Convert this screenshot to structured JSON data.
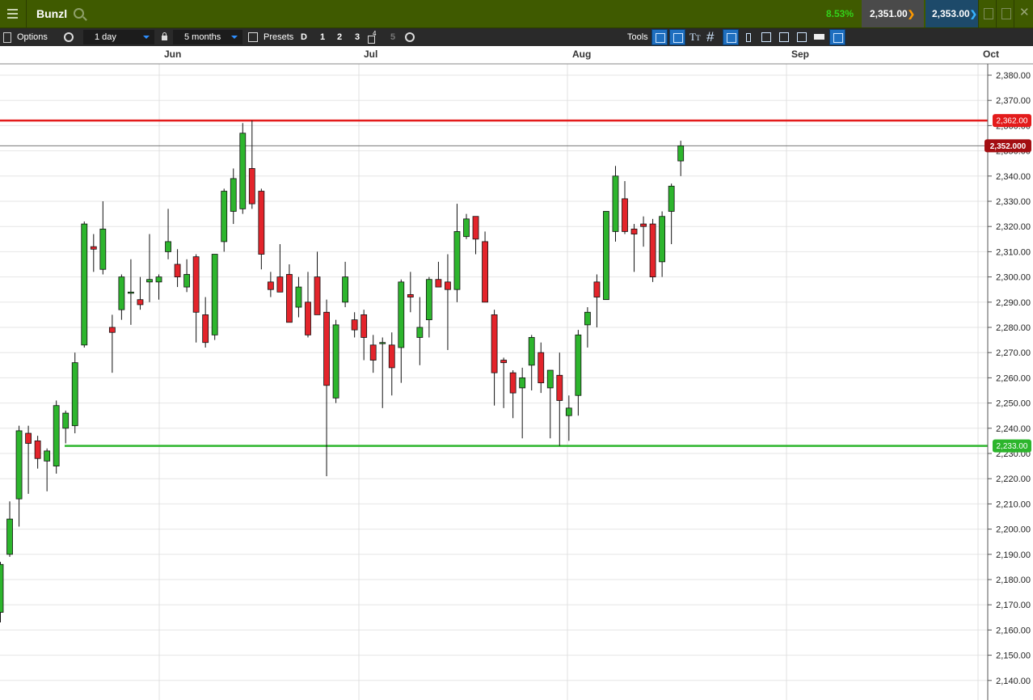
{
  "header": {
    "title": "Bunzl",
    "change": "8.53%",
    "sell": "2,351.00",
    "buy": "2,353.00"
  },
  "toolbar": {
    "options_label": "Options",
    "interval_value": "1 day",
    "range_value": "5 months",
    "presets_label": "Presets",
    "preset_buttons": [
      "D",
      "1",
      "2",
      "3",
      "4",
      "5"
    ],
    "tools_label": "Tools"
  },
  "colors": {
    "up": "#2db52d",
    "down": "#e3242b",
    "resistance": "#e31b1b",
    "support": "#2cb52c",
    "current": "#a30e12"
  },
  "chart_data": {
    "type": "candlestick",
    "title": "",
    "xlabel": "",
    "ylabel": "",
    "x_ticks": [
      "Jun",
      "Jul",
      "Aug",
      "Sep",
      "Oct"
    ],
    "ylim": [
      2135,
      2392
    ],
    "y_ticks": [
      2140,
      2150,
      2160,
      2170,
      2180,
      2190,
      2200,
      2210,
      2220,
      2230,
      2240,
      2250,
      2260,
      2270,
      2280,
      2290,
      2300,
      2310,
      2320,
      2330,
      2340,
      2350,
      2360,
      2370,
      2380
    ],
    "y_tick_labels": [
      "2,140.00",
      "2,150.00",
      "2,160.00",
      "2,170.00",
      "2,180.00",
      "2,190.00",
      "2,200.00",
      "2,210.00",
      "2,220.00",
      "2,230.00",
      "2,240.00",
      "2,250.00",
      "2,260.00",
      "2,270.00",
      "2,280.00",
      "2,290.00",
      "2,300.00",
      "2,310.00",
      "2,320.00",
      "2,330.00",
      "2,340.00",
      "2,350.00",
      "2,360.00",
      "2,370.00",
      "2,380.00"
    ],
    "grid": true,
    "candles": [
      {
        "date": "05-24",
        "o": 2167,
        "h": 2187,
        "l": 2163,
        "c": 2186
      },
      {
        "date": "05-25",
        "o": 2190,
        "h": 2211,
        "l": 2189,
        "c": 2204
      },
      {
        "date": "05-26",
        "o": 2212,
        "h": 2241,
        "l": 2201,
        "c": 2239
      },
      {
        "date": "05-29",
        "o": 2238,
        "h": 2241,
        "l": 2214,
        "c": 2234
      },
      {
        "date": "05-30",
        "o": 2235,
        "h": 2237,
        "l": 2224,
        "c": 2228
      },
      {
        "date": "05-31",
        "o": 2227,
        "h": 2232,
        "l": 2215,
        "c": 2231
      },
      {
        "date": "06-01",
        "o": 2225,
        "h": 2251,
        "l": 2222,
        "c": 2249
      },
      {
        "date": "06-02",
        "o": 2240,
        "h": 2247,
        "l": 2234,
        "c": 2246
      },
      {
        "date": "06-05",
        "o": 2241,
        "h": 2270,
        "l": 2238,
        "c": 2266
      },
      {
        "date": "06-06",
        "o": 2273,
        "h": 2322,
        "l": 2272,
        "c": 2321
      },
      {
        "date": "06-07",
        "o": 2312,
        "h": 2317,
        "l": 2302,
        "c": 2311
      },
      {
        "date": "06-08",
        "o": 2303,
        "h": 2330,
        "l": 2301,
        "c": 2319
      },
      {
        "date": "06-09",
        "o": 2280,
        "h": 2285,
        "l": 2262,
        "c": 2278
      },
      {
        "date": "06-12",
        "o": 2287,
        "h": 2301,
        "l": 2283,
        "c": 2300
      },
      {
        "date": "06-13",
        "o": 2294,
        "h": 2307,
        "l": 2281,
        "c": 2294
      },
      {
        "date": "06-14",
        "o": 2291,
        "h": 2300,
        "l": 2287,
        "c": 2289
      },
      {
        "date": "06-15",
        "o": 2298,
        "h": 2317,
        "l": 2290,
        "c": 2299
      },
      {
        "date": "06-16",
        "o": 2298,
        "h": 2301,
        "l": 2291,
        "c": 2300
      },
      {
        "date": "06-19",
        "o": 2310,
        "h": 2327,
        "l": 2307,
        "c": 2314
      },
      {
        "date": "06-20",
        "o": 2305,
        "h": 2311,
        "l": 2296,
        "c": 2300
      },
      {
        "date": "06-21",
        "o": 2296,
        "h": 2307,
        "l": 2294,
        "c": 2301
      },
      {
        "date": "06-22",
        "o": 2308,
        "h": 2309,
        "l": 2274,
        "c": 2286
      },
      {
        "date": "06-23",
        "o": 2285,
        "h": 2292,
        "l": 2272,
        "c": 2274
      },
      {
        "date": "06-26",
        "o": 2277,
        "h": 2309,
        "l": 2275,
        "c": 2309
      },
      {
        "date": "06-27",
        "o": 2314,
        "h": 2335,
        "l": 2310,
        "c": 2334
      },
      {
        "date": "06-28",
        "o": 2326,
        "h": 2343,
        "l": 2321,
        "c": 2339
      },
      {
        "date": "06-29",
        "o": 2327,
        "h": 2361,
        "l": 2325,
        "c": 2357
      },
      {
        "date": "06-30",
        "o": 2343,
        "h": 2362,
        "l": 2327,
        "c": 2329
      },
      {
        "date": "07-03",
        "o": 2334,
        "h": 2335,
        "l": 2303,
        "c": 2309
      },
      {
        "date": "07-04",
        "o": 2298,
        "h": 2302,
        "l": 2292,
        "c": 2295
      },
      {
        "date": "07-05",
        "o": 2300,
        "h": 2313,
        "l": 2296,
        "c": 2294
      },
      {
        "date": "07-06",
        "o": 2301,
        "h": 2305,
        "l": 2282,
        "c": 2282
      },
      {
        "date": "07-07",
        "o": 2288,
        "h": 2300,
        "l": 2284,
        "c": 2296
      },
      {
        "date": "07-10",
        "o": 2290,
        "h": 2302,
        "l": 2276,
        "c": 2277
      },
      {
        "date": "07-11",
        "o": 2300,
        "h": 2310,
        "l": 2289,
        "c": 2285
      },
      {
        "date": "07-12",
        "o": 2286,
        "h": 2291,
        "l": 2221,
        "c": 2257
      },
      {
        "date": "07-13",
        "o": 2252,
        "h": 2283,
        "l": 2250,
        "c": 2281
      },
      {
        "date": "07-14",
        "o": 2290,
        "h": 2306,
        "l": 2288,
        "c": 2300
      },
      {
        "date": "07-17",
        "o": 2283,
        "h": 2286,
        "l": 2276,
        "c": 2279
      },
      {
        "date": "07-18",
        "o": 2285,
        "h": 2287,
        "l": 2267,
        "c": 2276
      },
      {
        "date": "07-19",
        "o": 2273,
        "h": 2277,
        "l": 2262,
        "c": 2267
      },
      {
        "date": "07-20",
        "o": 2274,
        "h": 2276,
        "l": 2248,
        "c": 2274
      },
      {
        "date": "07-21",
        "o": 2273,
        "h": 2278,
        "l": 2253,
        "c": 2264
      },
      {
        "date": "07-24",
        "o": 2272,
        "h": 2299,
        "l": 2258,
        "c": 2298
      },
      {
        "date": "07-25",
        "o": 2293,
        "h": 2302,
        "l": 2286,
        "c": 2292
      },
      {
        "date": "07-26",
        "o": 2276,
        "h": 2292,
        "l": 2265,
        "c": 2280
      },
      {
        "date": "07-27",
        "o": 2283,
        "h": 2300,
        "l": 2276,
        "c": 2299
      },
      {
        "date": "07-28",
        "o": 2299,
        "h": 2306,
        "l": 2297,
        "c": 2296
      },
      {
        "date": "07-31",
        "o": 2298,
        "h": 2309,
        "l": 2271,
        "c": 2295
      },
      {
        "date": "08-01",
        "o": 2295,
        "h": 2329,
        "l": 2290,
        "c": 2318
      },
      {
        "date": "08-02",
        "o": 2316,
        "h": 2325,
        "l": 2315,
        "c": 2323
      },
      {
        "date": "08-03",
        "o": 2324,
        "h": 2322,
        "l": 2309,
        "c": 2315
      },
      {
        "date": "08-04",
        "o": 2314,
        "h": 2318,
        "l": 2297,
        "c": 2290
      },
      {
        "date": "08-07",
        "o": 2285,
        "h": 2287,
        "l": 2249,
        "c": 2262
      },
      {
        "date": "08-08",
        "o": 2267,
        "h": 2268,
        "l": 2248,
        "c": 2266
      },
      {
        "date": "08-09",
        "o": 2262,
        "h": 2263,
        "l": 2244,
        "c": 2254
      },
      {
        "date": "08-10",
        "o": 2256,
        "h": 2264,
        "l": 2236,
        "c": 2260
      },
      {
        "date": "08-11",
        "o": 2265,
        "h": 2277,
        "l": 2255,
        "c": 2276
      },
      {
        "date": "08-14",
        "o": 2270,
        "h": 2274,
        "l": 2254,
        "c": 2258
      },
      {
        "date": "08-15",
        "o": 2256,
        "h": 2263,
        "l": 2236,
        "c": 2263
      },
      {
        "date": "08-16",
        "o": 2261,
        "h": 2270,
        "l": 2233,
        "c": 2251
      },
      {
        "date": "08-17",
        "o": 2245,
        "h": 2253,
        "l": 2235,
        "c": 2248
      },
      {
        "date": "08-18",
        "o": 2253,
        "h": 2279,
        "l": 2245,
        "c": 2277
      },
      {
        "date": "08-21",
        "o": 2281,
        "h": 2288,
        "l": 2272,
        "c": 2286
      },
      {
        "date": "08-22",
        "o": 2298,
        "h": 2301,
        "l": 2280,
        "c": 2292
      },
      {
        "date": "08-23",
        "o": 2291,
        "h": 2326,
        "l": 2291,
        "c": 2326
      },
      {
        "date": "08-24",
        "o": 2318,
        "h": 2344,
        "l": 2314,
        "c": 2340
      },
      {
        "date": "08-25",
        "o": 2331,
        "h": 2338,
        "l": 2317,
        "c": 2318
      },
      {
        "date": "08-28",
        "o": 2319,
        "h": 2321,
        "l": 2302,
        "c": 2317
      },
      {
        "date": "08-29",
        "o": 2321,
        "h": 2324,
        "l": 2312,
        "c": 2320
      },
      {
        "date": "08-30",
        "o": 2321,
        "h": 2323,
        "l": 2298,
        "c": 2300
      },
      {
        "date": "08-31",
        "o": 2306,
        "h": 2326,
        "l": 2300,
        "c": 2324
      },
      {
        "date": "09-01",
        "o": 2326,
        "h": 2337,
        "l": 2313,
        "c": 2336
      },
      {
        "date": "09-04",
        "o": 2346,
        "h": 2354,
        "l": 2340,
        "c": 2352
      }
    ],
    "horizontal_lines": [
      {
        "name": "resistance",
        "value": 2362,
        "label": "2,362.00"
      },
      {
        "name": "current",
        "value": 2352,
        "label": "2,352.000"
      },
      {
        "name": "support",
        "value": 2233,
        "label": "2,233.00"
      }
    ]
  }
}
